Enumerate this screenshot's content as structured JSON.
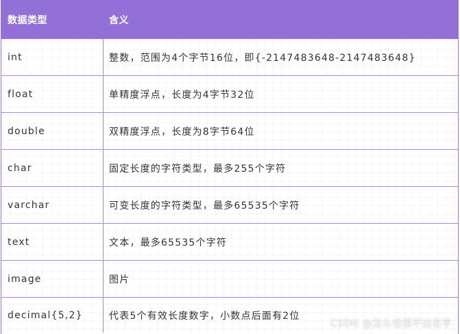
{
  "header": {
    "col1": "数据类型",
    "col2": "含义"
  },
  "rows": [
    {
      "type": "int",
      "meaning": "整数，范围为4个字节16位，即{-2147483648-2147483648}"
    },
    {
      "type": "float",
      "meaning": "单精度浮点，长度为4字节32位"
    },
    {
      "type": "double",
      "meaning": "双精度浮点，长度为8字节64位"
    },
    {
      "type": "char",
      "meaning": "固定长度的字符类型，最多255个字符"
    },
    {
      "type": "varchar",
      "meaning": "可变长度的字符类型，最多65535个字符"
    },
    {
      "type": "text",
      "meaning": "文本，最多65535个字符"
    },
    {
      "type": "image",
      "meaning": "图片"
    },
    {
      "type": "decimal{5,2}",
      "meaning": "代表5个有效长度数字，小数点后面有2位"
    }
  ],
  "watermark": "CSDN @怎么也想不出名字",
  "colors": {
    "header_bg": "#9370d8",
    "border": "#a489da",
    "text": "#333333"
  }
}
